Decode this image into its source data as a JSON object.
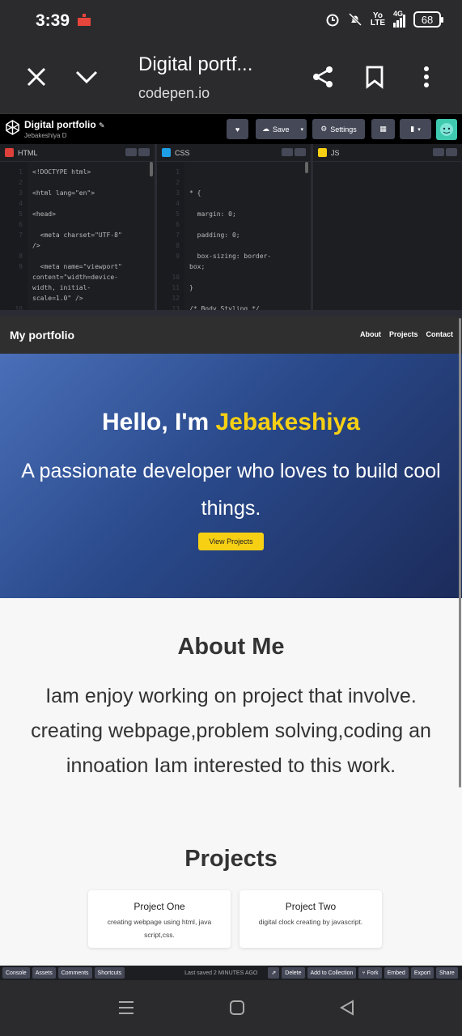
{
  "status_bar": {
    "time": "3:39",
    "battery": "68",
    "network": "4G",
    "volte_top": "Yo",
    "volte_bottom": "LTE"
  },
  "browser": {
    "title": "Digital portf...",
    "url": "codepen.io"
  },
  "codepen": {
    "pen_title": "Digital portfolio",
    "user": "Jebakeshiya D",
    "save_label": "Save",
    "settings_label": "Settings",
    "html_tab": "HTML",
    "css_tab": "CSS",
    "js_tab": "JS",
    "html_lines": [
      {
        "n": "1",
        "text": "<!DOCTYPE html>"
      },
      {
        "n": "2",
        "text": ""
      },
      {
        "n": "3",
        "text": "<html lang=\"en\">"
      },
      {
        "n": "4",
        "text": ""
      },
      {
        "n": "5",
        "text": "<head>"
      },
      {
        "n": "6",
        "text": ""
      },
      {
        "n": "7",
        "text": "  <meta charset=\"UTF-8\""
      },
      {
        "n": "",
        "text": "/>"
      },
      {
        "n": "8",
        "text": ""
      },
      {
        "n": "9",
        "text": "  <meta name=\"viewport\""
      },
      {
        "n": "",
        "text": "content=\"width=device-"
      },
      {
        "n": "",
        "text": "width, initial-"
      },
      {
        "n": "",
        "text": "scale=1.0\" />"
      },
      {
        "n": "10",
        "text": ""
      }
    ],
    "css_lines": [
      {
        "n": "1",
        "text": ""
      },
      {
        "n": "2",
        "text": ""
      },
      {
        "n": "3",
        "text": "* {"
      },
      {
        "n": "4",
        "text": ""
      },
      {
        "n": "5",
        "text": "  margin: 0;"
      },
      {
        "n": "6",
        "text": ""
      },
      {
        "n": "7",
        "text": "  padding: 0;"
      },
      {
        "n": "8",
        "text": ""
      },
      {
        "n": "9",
        "text": "  box-sizing: border-"
      },
      {
        "n": "",
        "text": "box;"
      },
      {
        "n": "10",
        "text": ""
      },
      {
        "n": "11",
        "text": "}"
      },
      {
        "n": "12",
        "text": ""
      },
      {
        "n": "13",
        "text": "/* Body Styling */"
      }
    ],
    "footer_left": [
      "Console",
      "Assets",
      "Comments",
      "Shortcuts"
    ],
    "last_saved": "Last saved 2 MINUTES AGO",
    "footer_right": [
      "Delete",
      "Add to Collection",
      "Fork",
      "Embed",
      "Export",
      "Share"
    ]
  },
  "preview": {
    "brand": "My portfolio",
    "nav_links": [
      "About",
      "Projects",
      "Contact"
    ],
    "hero_greeting": "Hello, I'm ",
    "hero_name": "Jebakeshiya",
    "hero_tagline": "A passionate developer who loves to build cool things.",
    "hero_button": "View Projects",
    "about_title": "About Me",
    "about_text": "Iam enjoy working on project that involve. creating webpage,problem solving,coding an innoation Iam interested to this work.",
    "projects_title": "Projects",
    "projects": [
      {
        "title": "Project One",
        "desc": "creating webpage using html, java script,css."
      },
      {
        "title": "Project Two",
        "desc": "digital clock creating by javascript."
      }
    ]
  },
  "colors": {
    "accent_yellow": "#f7d014",
    "hero_start": "#4a6fb8",
    "hero_end": "#1c2b5a",
    "nav_dark": "#2f2f2f"
  }
}
